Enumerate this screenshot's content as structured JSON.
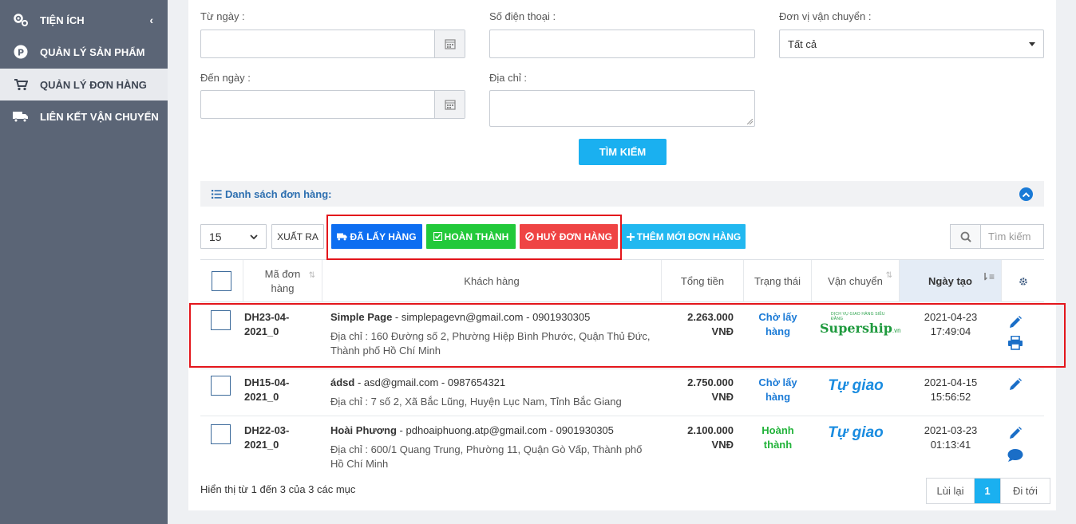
{
  "sidebar": {
    "items": [
      {
        "label": "TIỆN ÍCH",
        "icon": "gears-icon"
      },
      {
        "label": "QUẢN LÝ SẢN PHẨM",
        "icon": "product-p-icon"
      },
      {
        "label": "QUẢN LÝ ĐƠN HÀNG",
        "icon": "cart-icon"
      },
      {
        "label": "LIÊN KẾT VẬN CHUYỂN",
        "icon": "truck-icon"
      }
    ],
    "collapse_glyph": "‹"
  },
  "filters": {
    "from_date_label": "Từ ngày :",
    "to_date_label": "Đến ngày :",
    "phone_label": "Số điện thoại :",
    "address_label": "Địa chỉ :",
    "carrier_label": "Đơn vị vận chuyển :",
    "carrier_value": "Tất cả",
    "search_button": "TÌM KIẾM"
  },
  "list": {
    "header": "Danh sách đơn hàng:",
    "per_page": "15",
    "export": "XUẤT RA",
    "btn_picked": "ĐÃ LẤY HÀNG",
    "btn_done": "HOÀN THÀNH",
    "btn_cancel": "HUỶ ĐƠN HÀNG",
    "btn_add": "THÊM MỚI ĐƠN HÀNG",
    "search_placeholder": "Tìm kiếm"
  },
  "table": {
    "columns": {
      "code": "Mã đơn hàng",
      "customer": "Khách hàng",
      "total": "Tổng tiền",
      "status": "Trạng thái",
      "shipping": "Vận chuyển",
      "created": "Ngày tạo"
    },
    "rows": [
      {
        "code": "DH23-04-2021_0",
        "name": "Simple Page",
        "contact": " - simplepagevn@gmail.com - 0901930305",
        "address": "Địa chỉ : 160 Đường số 2, Phường Hiệp Bình Phước, Quận Thủ Đức, Thành phố Hồ Chí Minh",
        "amount": "2.263.000",
        "currency": "VNĐ",
        "status": "Chờ lấy hàng",
        "shipping": "Supership",
        "shipping_tagline": "DỊCH VỤ GIAO HÀNG SIÊU ĐẲNG",
        "shipping_suffix": ".vn",
        "date": "2021-04-23",
        "time": "17:49:04"
      },
      {
        "code": "DH15-04-2021_0",
        "name": "ádsd",
        "contact": " - asd@gmail.com - 0987654321",
        "address": "Địa chỉ : 7 số 2, Xã Bắc Lũng, Huyện Lục Nam, Tỉnh Bắc Giang",
        "amount": "2.750.000",
        "currency": "VNĐ",
        "status": "Chờ lấy hàng",
        "shipping": "Tự giao",
        "date": "2021-04-15",
        "time": "15:56:52"
      },
      {
        "code": "DH22-03-2021_0",
        "name": "Hoài Phương",
        "contact": " - pdhoaiphuong.atp@gmail.com - 0901930305",
        "address": "Địa chỉ : 600/1 Quang Trung, Phường 11, Quận Gò Vấp, Thành phố Hồ Chí Minh",
        "amount": "2.100.000",
        "currency": "VNĐ",
        "status": "Hoành thành",
        "shipping": "Tự giao",
        "date": "2021-03-23",
        "time": "01:13:41"
      }
    ]
  },
  "footer": {
    "info": "Hiển thị từ 1 đến 3 của 3 các mục",
    "prev": "Lùi lại",
    "current": "1",
    "next": "Đi tới"
  },
  "colors": {
    "sidebar_bg": "#5b6576",
    "primary": "#1ab0f0",
    "picked": "#0d6ef1",
    "done": "#22c93a",
    "cancel": "#ef4444",
    "highlight": "#e3161c"
  }
}
